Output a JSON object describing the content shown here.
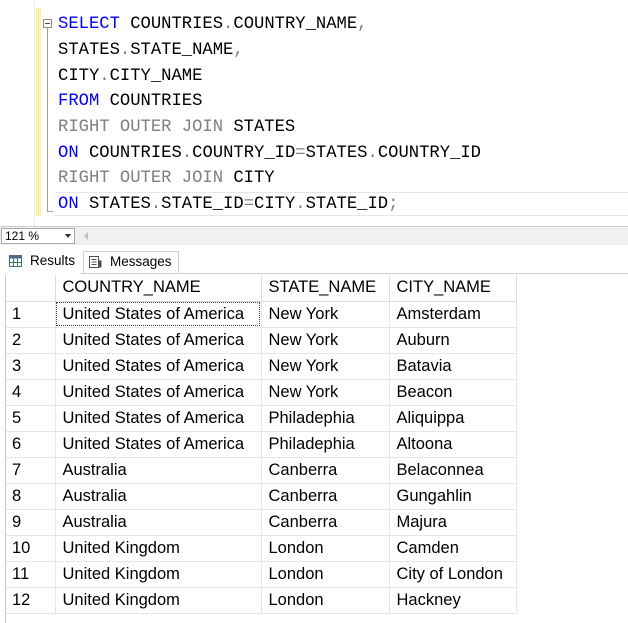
{
  "editor": {
    "lines": [
      [
        {
          "t": "SELECT",
          "c": "kw"
        },
        {
          "t": " COUNTRIES",
          "c": "id"
        },
        {
          "t": ".",
          "c": "gray"
        },
        {
          "t": "COUNTRY_NAME",
          "c": "id"
        },
        {
          "t": ",",
          "c": "gray"
        }
      ],
      [
        {
          "t": "STATES",
          "c": "id"
        },
        {
          "t": ".",
          "c": "gray"
        },
        {
          "t": "STATE_NAME",
          "c": "id"
        },
        {
          "t": ",",
          "c": "gray"
        }
      ],
      [
        {
          "t": "CITY",
          "c": "id"
        },
        {
          "t": ".",
          "c": "gray"
        },
        {
          "t": "CITY_NAME",
          "c": "id"
        }
      ],
      [
        {
          "t": "FROM",
          "c": "kw"
        },
        {
          "t": " COUNTRIES",
          "c": "id"
        }
      ],
      [
        {
          "t": "RIGHT OUTER JOIN",
          "c": "gray"
        },
        {
          "t": " STATES",
          "c": "id"
        }
      ],
      [
        {
          "t": "ON",
          "c": "kw"
        },
        {
          "t": " COUNTRIES",
          "c": "id"
        },
        {
          "t": ".",
          "c": "gray"
        },
        {
          "t": "COUNTRY_ID",
          "c": "id"
        },
        {
          "t": "=",
          "c": "gray"
        },
        {
          "t": "STATES",
          "c": "id"
        },
        {
          "t": ".",
          "c": "gray"
        },
        {
          "t": "COUNTRY_ID",
          "c": "id"
        }
      ],
      [
        {
          "t": "RIGHT OUTER JOIN",
          "c": "gray"
        },
        {
          "t": " CITY",
          "c": "id"
        }
      ],
      [
        {
          "t": "ON",
          "c": "kw"
        },
        {
          "t": " STATES",
          "c": "id"
        },
        {
          "t": ".",
          "c": "gray"
        },
        {
          "t": "STATE_ID",
          "c": "id"
        },
        {
          "t": "=",
          "c": "gray"
        },
        {
          "t": "CITY",
          "c": "id"
        },
        {
          "t": ".",
          "c": "gray"
        },
        {
          "t": "STATE_ID",
          "c": "id"
        },
        {
          "t": ";",
          "c": "gray"
        }
      ]
    ]
  },
  "zoom": {
    "value": "121 %"
  },
  "tabs": {
    "results_label": "Results",
    "messages_label": "Messages",
    "results_icon": "grid-icon",
    "messages_icon": "messages-icon"
  },
  "grid": {
    "columns": [
      "COUNTRY_NAME",
      "STATE_NAME",
      "CITY_NAME"
    ],
    "rows": [
      {
        "num": "1",
        "cells": [
          "United States of America",
          "New York",
          "Amsterdam"
        ]
      },
      {
        "num": "2",
        "cells": [
          "United States of America",
          "New York",
          "Auburn"
        ]
      },
      {
        "num": "3",
        "cells": [
          "United States of America",
          "New York",
          "Batavia"
        ]
      },
      {
        "num": "4",
        "cells": [
          "United States of America",
          "New York",
          "Beacon"
        ]
      },
      {
        "num": "5",
        "cells": [
          "United States of America",
          "Philadephia",
          "Aliquippa"
        ]
      },
      {
        "num": "6",
        "cells": [
          "United States of America",
          "Philadephia",
          "Altoona"
        ]
      },
      {
        "num": "7",
        "cells": [
          "Australia",
          "Canberra",
          "Belaconnea"
        ]
      },
      {
        "num": "8",
        "cells": [
          "Australia",
          "Canberra",
          "Gungahlin"
        ]
      },
      {
        "num": "9",
        "cells": [
          "Australia",
          "Canberra",
          "Majura"
        ]
      },
      {
        "num": "10",
        "cells": [
          "United Kingdom",
          "London",
          "Camden"
        ]
      },
      {
        "num": "11",
        "cells": [
          "United Kingdom",
          "London",
          "City of London"
        ]
      },
      {
        "num": "12",
        "cells": [
          "United Kingdom",
          "London",
          "Hackney"
        ]
      }
    ]
  },
  "colors": {
    "keyword": "#0000ff",
    "operator": "#808080",
    "identifier": "#000000",
    "change_bar": "#f7f3a8"
  }
}
